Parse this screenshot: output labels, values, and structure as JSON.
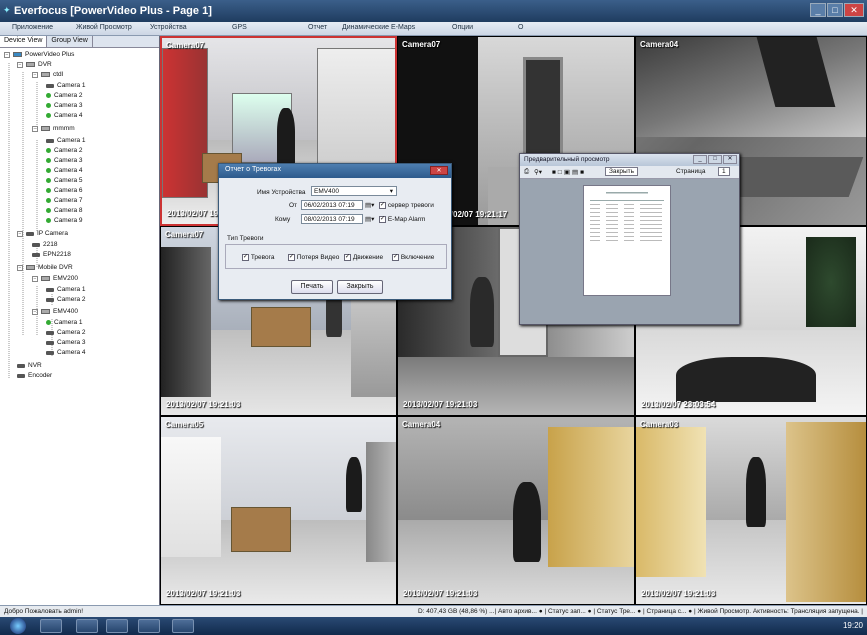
{
  "window": {
    "title": "Everfocus  [PowerVideo Plus - Page 1]"
  },
  "menu": [
    "Приложение",
    "Живой Просмотр",
    "Устройства",
    "GPS",
    "Отчет",
    "Динамические E-Maps",
    "Опции",
    "O"
  ],
  "tree": {
    "tabs": [
      "Device View",
      "Group View"
    ],
    "nodes": [
      "PowerVideo Plus",
      "DVR",
      "ctdl",
      "Camera 1",
      "Camera 2",
      "Camera 3",
      "Camera 4",
      "mmmm",
      "Camera 1",
      "Camera 2",
      "Camera 3",
      "Camera 4",
      "Camera 5",
      "Camera 6",
      "Camera 7",
      "Camera 8",
      "Camera 9",
      "IP Camera",
      "2218",
      "EPN2218",
      "Mobile DVR",
      "EMV200",
      "Camera 1",
      "Camera 2",
      "EMV400",
      "Camera 1",
      "Camera 2",
      "Camera 3",
      "Camera 4",
      "NVR",
      "Encoder"
    ]
  },
  "cameras": [
    {
      "label": "Camera07",
      "timestamp": "2013/02/07  19:2"
    },
    {
      "label": "Camera07",
      "timestamp": "2013/02/07 19:21:17"
    },
    {
      "label": "Camera04",
      "timestamp": ""
    },
    {
      "label": "Camera07",
      "timestamp": "2013/02/07  19:21:03"
    },
    {
      "label": "",
      "timestamp": "2013/02/07  19:21:03"
    },
    {
      "label": "",
      "timestamp": "2013/02/07  23:03:54"
    },
    {
      "label": "Camera05",
      "timestamp": "2013/02/07  19:21:03"
    },
    {
      "label": "Camera04",
      "timestamp": "2013/02/07  19:21:03"
    },
    {
      "label": "Camera03",
      "timestamp": "2013/02/07  19:21:03"
    }
  ],
  "alarm_dialog": {
    "title": "Отчет о Тревогах",
    "device_label": "Имя Устройства",
    "device_value": "EMV400",
    "from_label": "От",
    "from_value": "06/02/2013 07:19",
    "to_label": "Кому",
    "to_value": "08/02/2013 07:19",
    "alarm_server": "сервер тревоги",
    "emap_alarm": "E-Map Alarm",
    "type_label": "Тип Тревоги",
    "types": [
      "Тревога",
      "Потеря Видео",
      "Движение",
      "Включение"
    ],
    "print_button": "Печать",
    "close_button": "Закрыть"
  },
  "preview": {
    "title": "Предварительный просмотр",
    "close_button": "Закрыть",
    "page_label": "Страница",
    "page_value": "1"
  },
  "status": {
    "left": "Добро Пожаловать admin!",
    "right": "D: 407,43 GB (48,86 %) ...| Авто архив... ● | Статус зап... ● | Статус Тре... ● | Страница с... ● | Живой Просмотр. Активность: Трансляция запущена. |"
  },
  "taskbar": {
    "time": "19:20"
  }
}
